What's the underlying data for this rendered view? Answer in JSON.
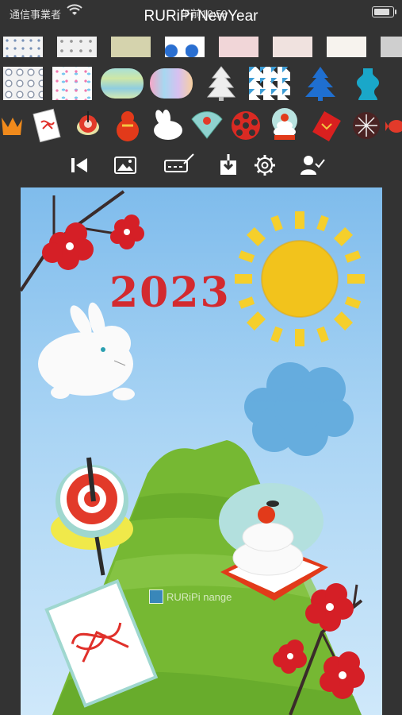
{
  "status": {
    "carrier": "通信事業者",
    "time": "午前10:53"
  },
  "app": {
    "title": "RURiPi NewYear"
  },
  "canvas": {
    "year_text": "2023"
  },
  "watermark": {
    "text": "RURiPi nange"
  },
  "toolbar": {
    "icons": [
      "skip-back-icon",
      "image-icon",
      "signature-icon",
      "download-icon",
      "gear-icon",
      "user-check-icon"
    ]
  },
  "palette": {
    "sun": "#f2c31c",
    "plum_red": "#d51f26",
    "cloud_blue": "#5fa9dc",
    "mountain_green": "#6fb52e",
    "sky_top": "#7fbcec"
  }
}
